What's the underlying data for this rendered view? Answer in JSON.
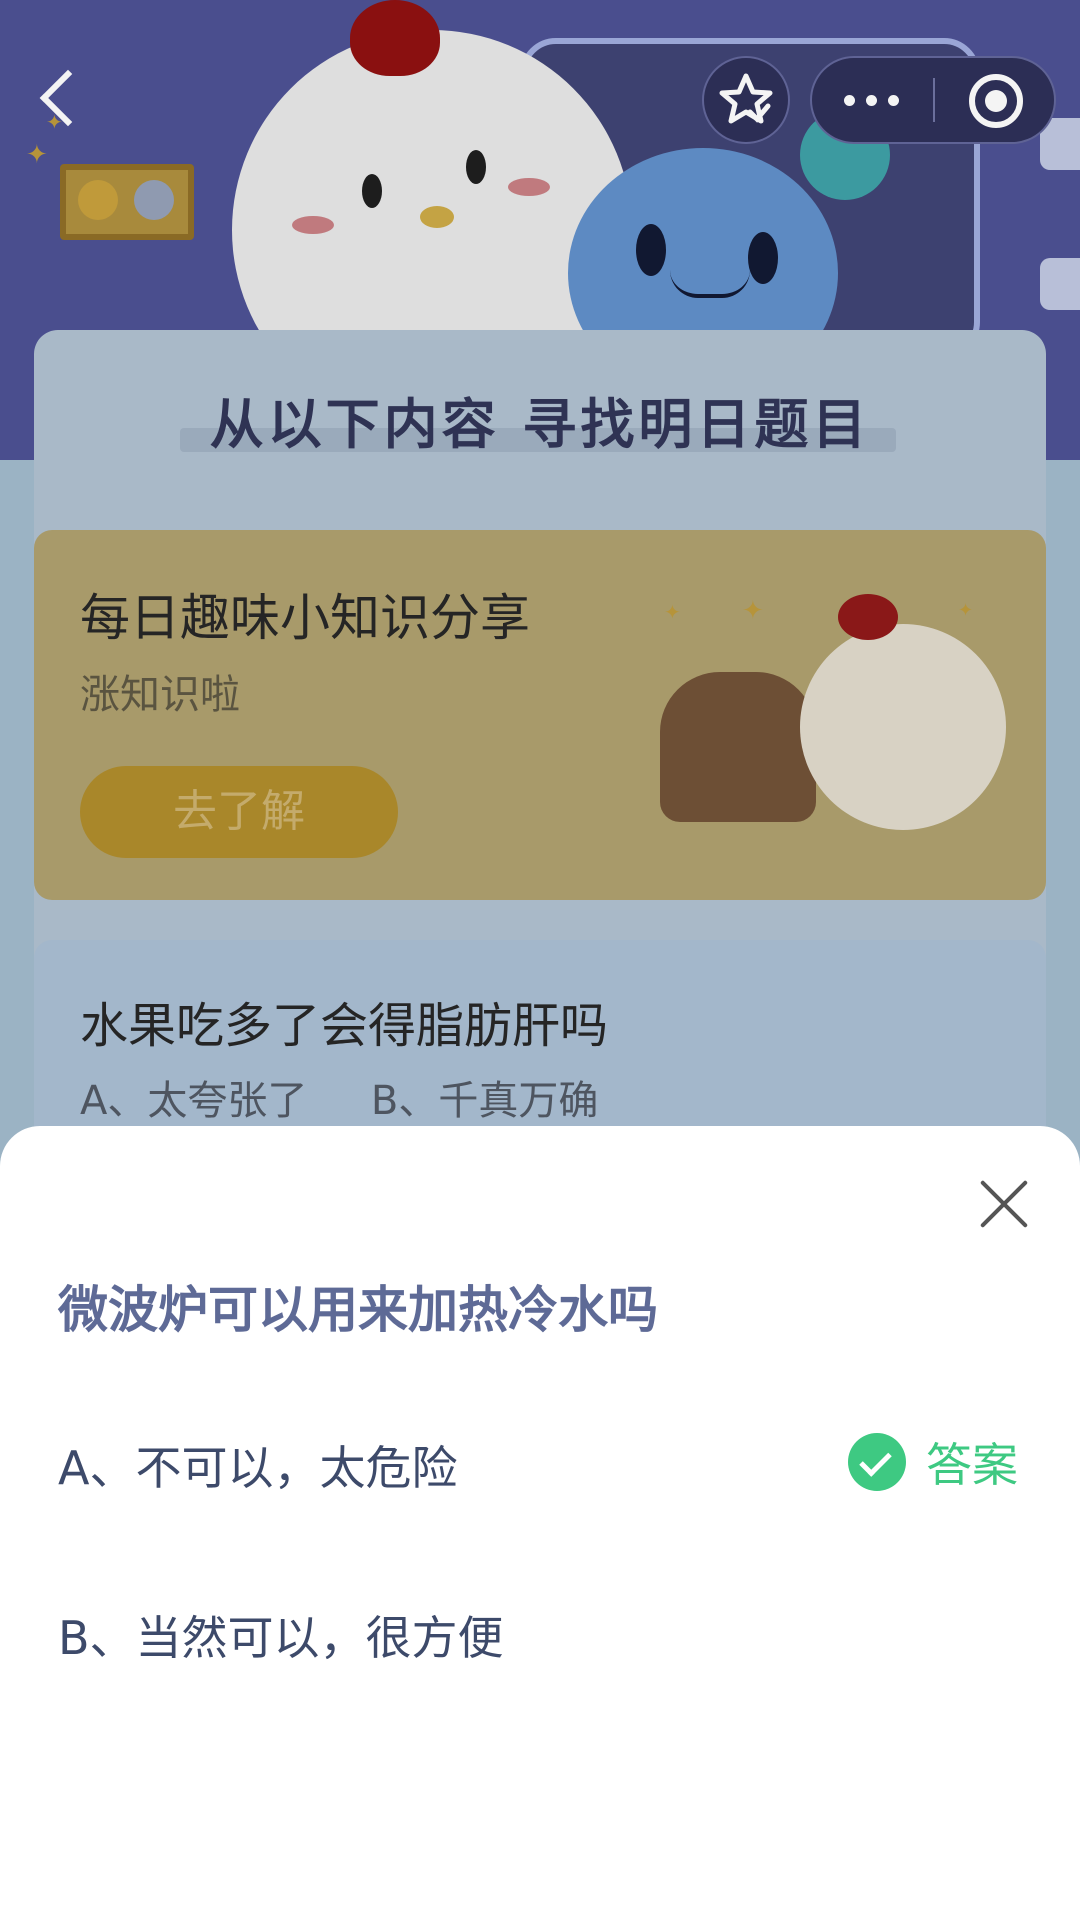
{
  "nav": {
    "back_icon": "chevron-left-icon",
    "favorite_icon": "star-check-icon",
    "more_icon": "ellipsis-icon",
    "close_icon": "target-circle-icon"
  },
  "section": {
    "title": "从以下内容  寻找明日题目"
  },
  "promo": {
    "title": "每日趣味小知识分享",
    "subtitle": "涨知识啦",
    "button": "去了解"
  },
  "preview_question": {
    "title": "水果吃多了会得脂肪肝吗",
    "options": "A、太夸张了     B、千真万确"
  },
  "sheet": {
    "question": "微波炉可以用来加热冷水吗",
    "option_a": "A、不可以，太危险",
    "option_b": "B、当然可以，很方便",
    "answer_tag": "答案",
    "answer_color": "#3ec982",
    "close_icon": "close-x-icon"
  }
}
